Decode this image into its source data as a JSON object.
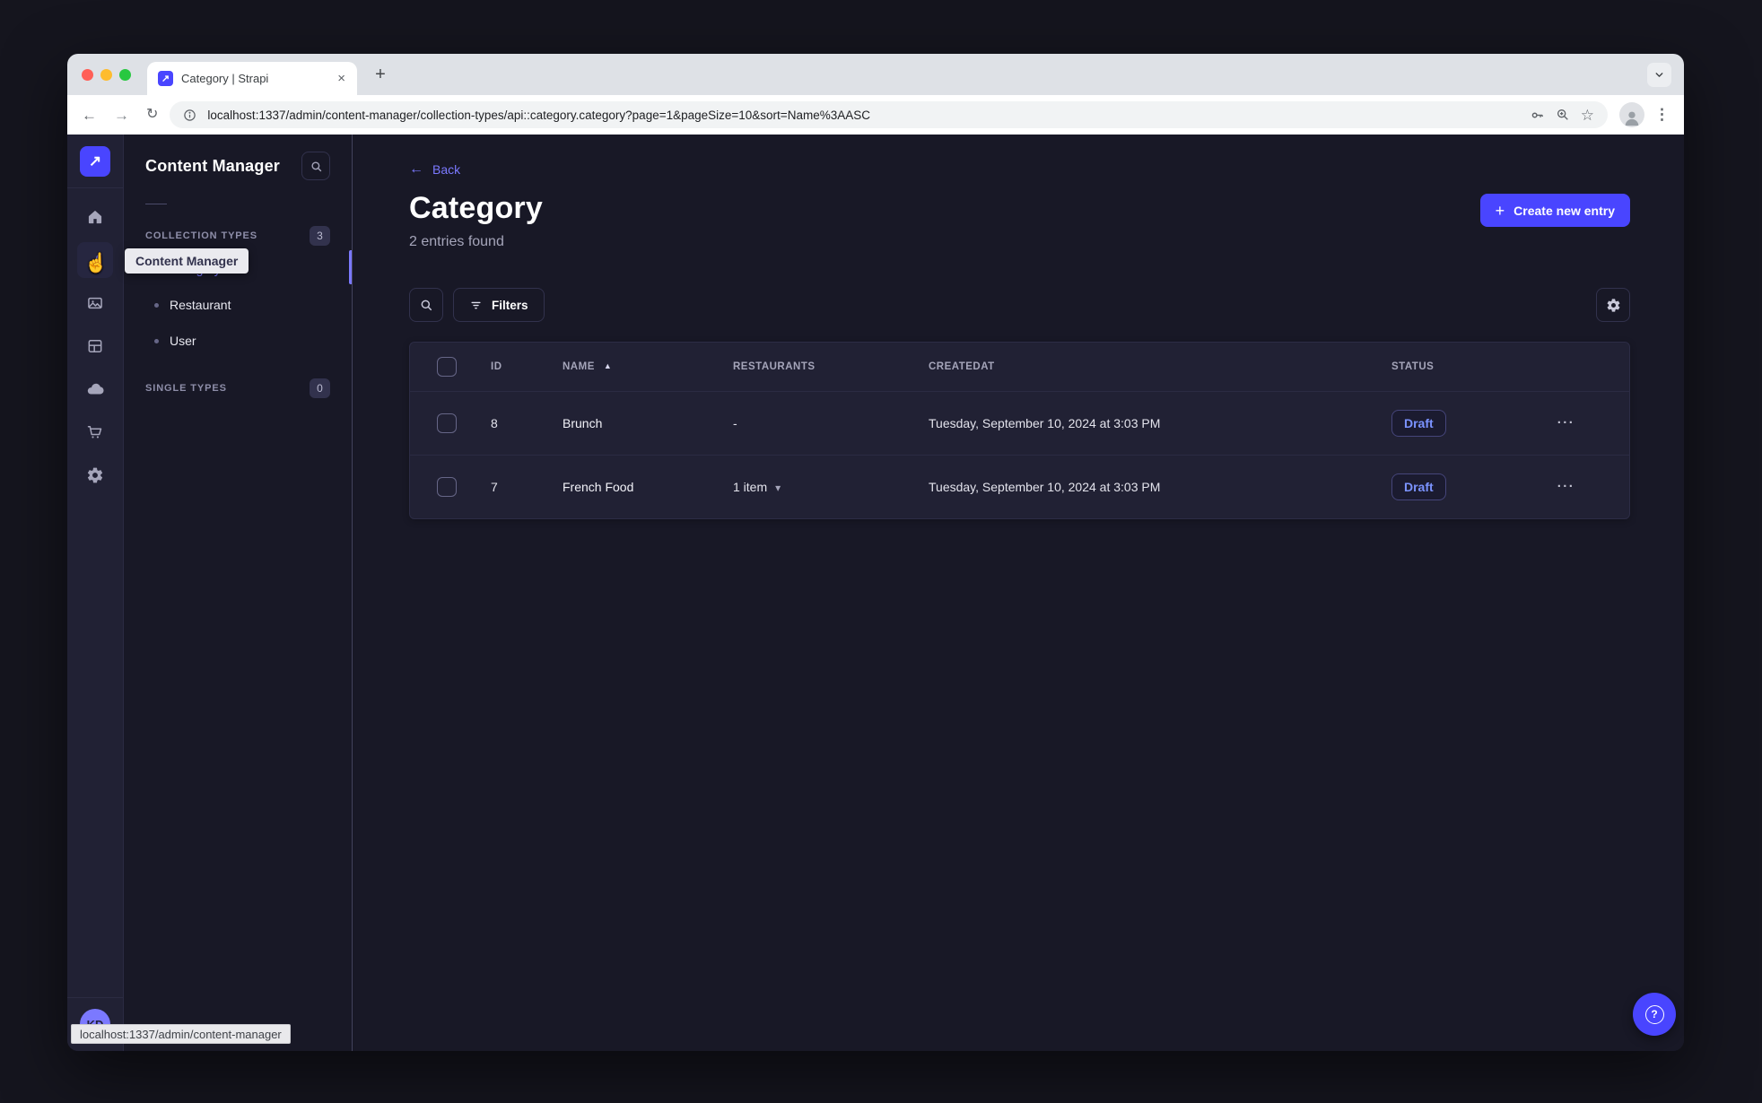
{
  "colors": {
    "accent": "#4945ff",
    "accent_light": "#7b79ff",
    "draft_text": "#7b93ff",
    "traffic_red": "#ff5f57",
    "traffic_yellow": "#febc2e",
    "traffic_green": "#28c840"
  },
  "browser": {
    "tab_title": "Category | Strapi",
    "url": "localhost:1337/admin/content-manager/collection-types/api::category.category?page=1&pageSize=10&sort=Name%3AASC",
    "status_tooltip": "localhost:1337/admin/content-manager"
  },
  "icons": {
    "logo_arrow": "↗",
    "close": "×",
    "new_tab": "+",
    "back": "←",
    "forward": "→",
    "reload": "↻",
    "menu_dots": "⋮",
    "star": "☆",
    "sort_asc": "▲",
    "caret_down": "▾",
    "ellipsis": "···",
    "plus": "+",
    "cursor": "☝",
    "help": "?"
  },
  "sidebar": {
    "tooltip": "Content Manager",
    "avatar": "KD"
  },
  "subnav": {
    "title": "Content Manager",
    "collection_types": {
      "label": "COLLECTION TYPES",
      "badge": "3",
      "items": [
        {
          "label": "Category",
          "active": true
        },
        {
          "label": "Restaurant"
        },
        {
          "label": "User"
        }
      ]
    },
    "single_types": {
      "label": "SINGLE TYPES",
      "badge": "0"
    }
  },
  "main": {
    "back_label": "Back",
    "title": "Category",
    "subtitle": "2 entries found",
    "create_button": "Create new entry",
    "filters_button": "Filters",
    "table": {
      "columns": [
        "ID",
        "NAME",
        "RESTAURANTS",
        "CREATEDAT",
        "STATUS"
      ],
      "rows": [
        {
          "id": "8",
          "name": "Brunch",
          "restaurants": "-",
          "createdAt": "Tuesday, September 10, 2024 at 3:03 PM",
          "status": "Draft"
        },
        {
          "id": "7",
          "name": "French Food",
          "restaurants": "1 item",
          "createdAt": "Tuesday, September 10, 2024 at 3:03 PM",
          "status": "Draft"
        }
      ]
    }
  }
}
